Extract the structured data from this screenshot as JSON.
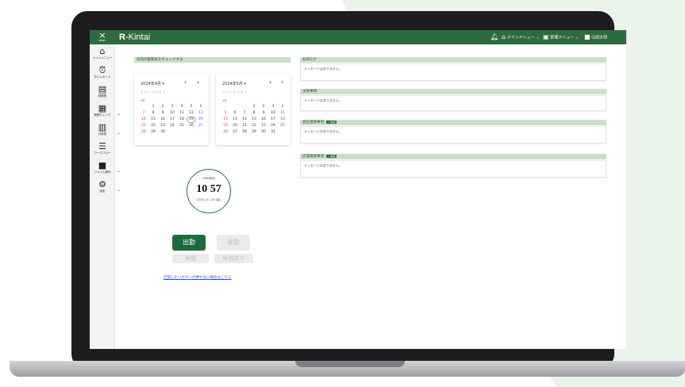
{
  "header": {
    "menu_label": "MENU",
    "app_name_r": "R",
    "app_name_rest": "-Kintai",
    "main_menu": "メインメニュー",
    "admin_menu": "管理メニュー",
    "user": "山田太郎"
  },
  "sidebar": {
    "items": [
      {
        "icon": "home-icon",
        "label": "メインメニュー"
      },
      {
        "icon": "alarm-clock-icon",
        "label": "タイムカード"
      },
      {
        "icon": "calendar-icon",
        "label": "勤務表"
      },
      {
        "icon": "clipboard-icon",
        "label": "勤務チェック"
      },
      {
        "icon": "bar-chart-icon",
        "label": "分析表"
      },
      {
        "icon": "list-icon",
        "label": "ワークフロー"
      },
      {
        "icon": "folder-icon",
        "label": "ファイル操作"
      },
      {
        "icon": "gear-icon",
        "label": "設定"
      }
    ]
  },
  "attendance_panel": {
    "title": "日別の勤務表をチェックする"
  },
  "calendars": [
    {
      "title": "2024年4月",
      "dow": "日 月 火 水 木 金 土",
      "month": "4月",
      "rows": [
        [
          "",
          "1",
          "2",
          "3",
          "4",
          "5",
          "6"
        ],
        [
          "7",
          "8",
          "9",
          "10",
          "11",
          "12",
          "13"
        ],
        [
          "14",
          "15",
          "16",
          "17",
          "18",
          "19",
          "20"
        ],
        [
          "21",
          "22",
          "23",
          "24",
          "25",
          "26",
          "27"
        ],
        [
          "28",
          "29",
          "30",
          "",
          "",
          "",
          ""
        ]
      ]
    },
    {
      "title": "2024年5月",
      "dow": "日 月 火 水 木 金 土",
      "month": "5月",
      "rows": [
        [
          "",
          "",
          "",
          "1",
          "2",
          "3",
          "4"
        ],
        [
          "5",
          "6",
          "7",
          "8",
          "9",
          "10",
          "11"
        ],
        [
          "12",
          "13",
          "14",
          "15",
          "16",
          "17",
          "18"
        ],
        [
          "19",
          "20",
          "21",
          "22",
          "23",
          "24",
          "25"
        ],
        [
          "26",
          "27",
          "28",
          "29",
          "30",
          "31",
          ""
        ]
      ]
    }
  ],
  "clock": {
    "company": "OMN本社",
    "time": "10 57",
    "date": "2024 / 4 / 19 (金)"
  },
  "buttons": {
    "clock_in": "出勤",
    "clock_out": "退勤",
    "break": "休憩",
    "break_end": "休憩戻り",
    "help_link": "打刻したいボタンが押せない場合はこちら"
  },
  "notices": [
    {
      "title": "お知らせ",
      "badge": "",
      "message": "メッセージはありません。"
    },
    {
      "title": "注意事項",
      "badge": "",
      "message": "メッセージはありません。"
    },
    {
      "title": "会社連絡事項",
      "badge": "✓ 確認",
      "message": "メッセージはありません。"
    },
    {
      "title": "店舗連絡事項",
      "badge": "✓ 確認",
      "message": "メッセージはありません。"
    }
  ],
  "colors": {
    "brand": "#2e6b41",
    "panel_header": "#c8e0c8",
    "background_accent": "#e9f4e9"
  }
}
